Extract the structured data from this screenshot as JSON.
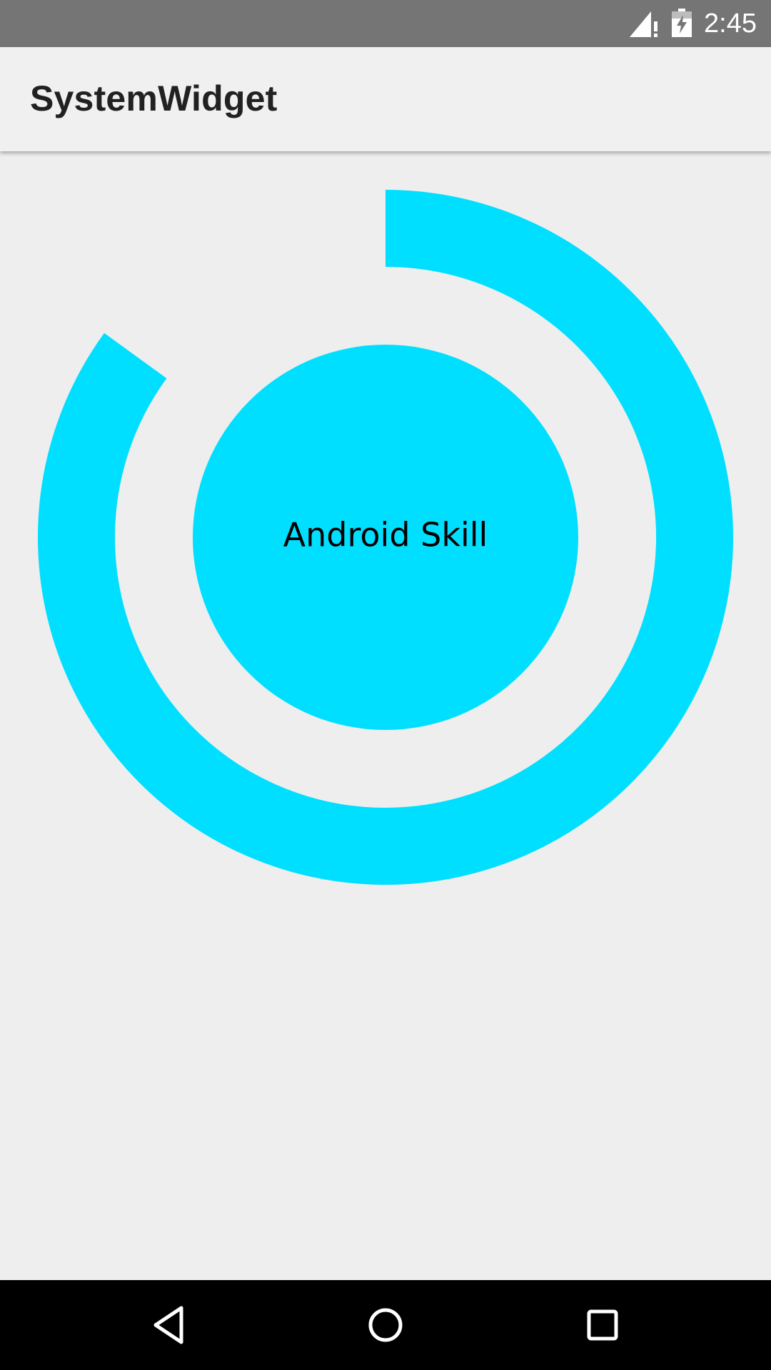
{
  "status_bar": {
    "time": "2:45",
    "icons": [
      "signal-no-data-icon",
      "battery-charging-icon"
    ]
  },
  "app_bar": {
    "title": "SystemWidget"
  },
  "widget": {
    "label": "Android Skill",
    "color": "#00dfff",
    "progress_fraction": 0.85
  },
  "nav_bar": {
    "buttons": [
      "back-icon",
      "home-icon",
      "recents-icon"
    ]
  }
}
